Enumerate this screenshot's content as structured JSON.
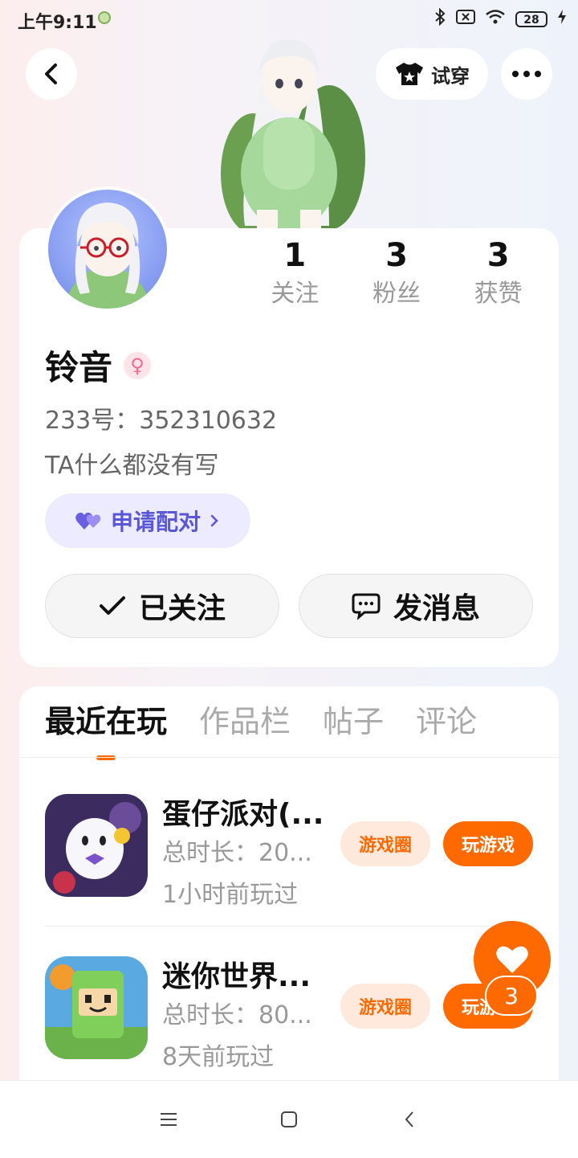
{
  "status_bar": {
    "time": "上午9:11",
    "battery": "28"
  },
  "header": {
    "try_on_label": "试穿",
    "try_on_icon": "shirt-icon",
    "back_icon": "chevron-left-icon",
    "more_icon": "more-icon"
  },
  "profile": {
    "name": "铃音",
    "gender_icon": "female-icon",
    "id_line": "233号：352310632",
    "bio": "TA什么都没有写",
    "pair_label": "申请配对",
    "follow_label": "已关注",
    "message_label": "发消息",
    "stats": [
      {
        "num": "1",
        "label": "关注"
      },
      {
        "num": "3",
        "label": "粉丝"
      },
      {
        "num": "3",
        "label": "获赞"
      }
    ]
  },
  "tabs": [
    "最近在玩",
    "作品栏",
    "帖子",
    "评论"
  ],
  "games": [
    {
      "title": "蛋仔派对(...",
      "duration": "总时长：20...",
      "last_played": "1小时前玩过",
      "circle_label": "游戏圈",
      "play_label": "玩游戏"
    },
    {
      "title": "迷你世界...",
      "duration": "总时长：80...",
      "last_played": "8天前玩过",
      "circle_label": "游戏圈",
      "play_label": "玩游戏"
    }
  ],
  "fab": {
    "badge": "3",
    "icon": "heart-icon"
  },
  "colors": {
    "accent": "#ff6a00",
    "pair_purple": "#5a57d6",
    "gender_pink": "#f06b92"
  }
}
